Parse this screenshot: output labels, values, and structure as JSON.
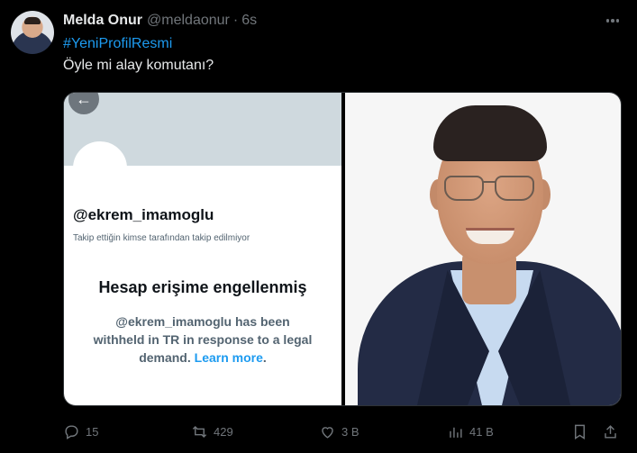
{
  "tweet": {
    "author_name": "Melda Onur",
    "author_handle": "@meldaonur",
    "separator": "·",
    "time": "6s",
    "hashtag": "#YeniProfilResmi",
    "text": "Öyle mi alay komutanı?"
  },
  "media": {
    "left_screenshot": {
      "account_handle": "@ekrem_imamoglu",
      "follow_note": "Takip ettiğin kimse tarafından takip edilmiyor",
      "withheld_title": "Hesap erişime engellenmiş",
      "withheld_description": "@ekrem_imamoglu has been withheld in TR in response to a legal demand.",
      "learn_more": "Learn more",
      "trailing_period": "."
    },
    "right_photo": {
      "subject": "portrait-photo"
    }
  },
  "actions": {
    "replies": "15",
    "reposts": "429",
    "likes": "3 B",
    "views": "41 B"
  },
  "colors": {
    "background": "#000000",
    "accent": "#1d9bf0",
    "muted": "#71767b",
    "text": "#e7e9ea"
  },
  "icons": [
    "more-icon",
    "back-arrow-icon",
    "reply-icon",
    "repost-icon",
    "like-icon",
    "views-icon",
    "bookmark-icon",
    "share-icon"
  ]
}
